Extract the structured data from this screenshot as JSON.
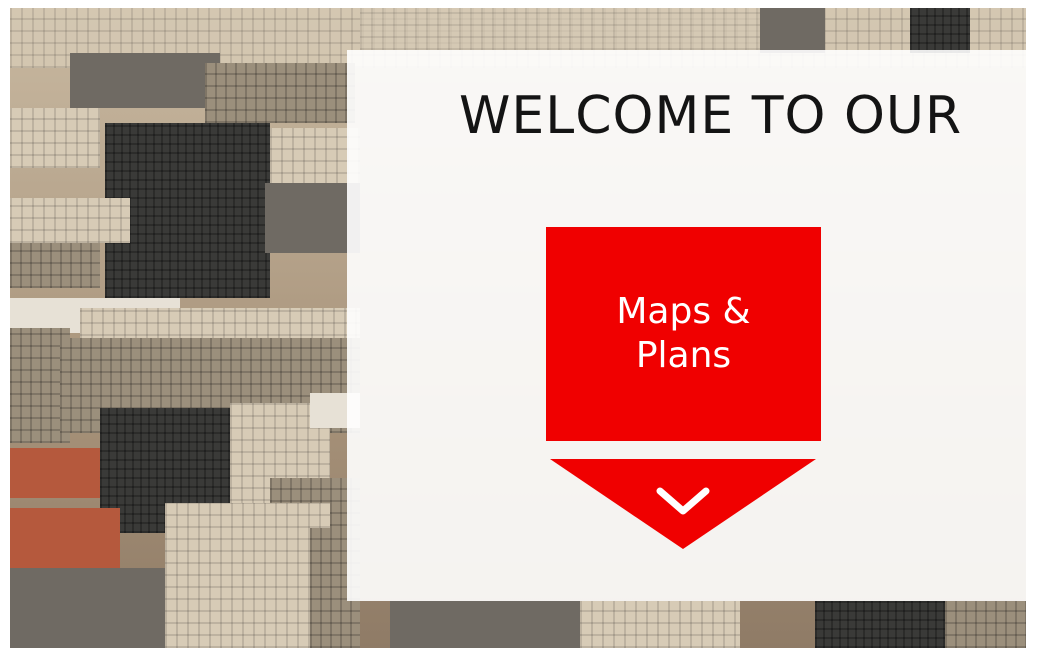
{
  "hero": {
    "heading": "WELCOME TO OUR",
    "cta_label": "Maps &\nPlans"
  },
  "icons": {
    "cta_arrow": "chevron-down-icon"
  },
  "colors": {
    "accent": "#f00000",
    "heading": "#141414",
    "panel": "#ffffff"
  }
}
